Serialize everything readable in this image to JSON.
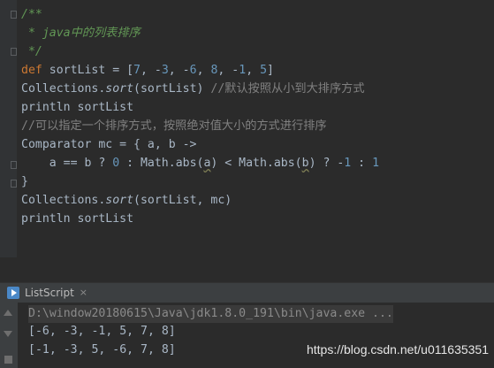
{
  "editor": {
    "lines": [
      {
        "tokens": [
          {
            "cls": "doc",
            "text": "/**"
          }
        ]
      },
      {
        "tokens": [
          {
            "cls": "doc",
            "text": " * java中的列表排序"
          }
        ]
      },
      {
        "tokens": [
          {
            "cls": "doc",
            "text": " */"
          }
        ]
      },
      {
        "tokens": [
          {
            "cls": "kw",
            "text": "def "
          },
          {
            "cls": "",
            "text": "sortList = ["
          },
          {
            "cls": "num",
            "text": "7"
          },
          {
            "cls": "",
            "text": ", -"
          },
          {
            "cls": "num",
            "text": "3"
          },
          {
            "cls": "",
            "text": ", -"
          },
          {
            "cls": "num",
            "text": "6"
          },
          {
            "cls": "",
            "text": ", "
          },
          {
            "cls": "num",
            "text": "8"
          },
          {
            "cls": "",
            "text": ", -"
          },
          {
            "cls": "num",
            "text": "1"
          },
          {
            "cls": "",
            "text": ", "
          },
          {
            "cls": "num",
            "text": "5"
          },
          {
            "cls": "",
            "text": "]"
          }
        ]
      },
      {
        "tokens": [
          {
            "cls": "",
            "text": "Collections."
          },
          {
            "cls": "it",
            "text": "sort"
          },
          {
            "cls": "",
            "text": "(sortList) "
          },
          {
            "cls": "cmt",
            "text": "//默认按照从小到大排序方式"
          }
        ]
      },
      {
        "tokens": [
          {
            "cls": "",
            "text": "println sortList"
          }
        ]
      },
      {
        "tokens": [
          {
            "cls": "cmt",
            "text": "//可以指定一个排序方式，按照绝对值大小的方式进行排序"
          }
        ]
      },
      {
        "tokens": [
          {
            "cls": "",
            "text": "Comparator mc = { a, b ->"
          }
        ]
      },
      {
        "tokens": [
          {
            "cls": "",
            "text": "    a == b ? "
          },
          {
            "cls": "num",
            "text": "0"
          },
          {
            "cls": "",
            "text": " : Math.abs("
          },
          {
            "cls": "under",
            "text": "a"
          },
          {
            "cls": "",
            "text": ") < Math.abs("
          },
          {
            "cls": "under",
            "text": "b"
          },
          {
            "cls": "",
            "text": ") ? -"
          },
          {
            "cls": "num",
            "text": "1"
          },
          {
            "cls": "",
            "text": " : "
          },
          {
            "cls": "num",
            "text": "1"
          }
        ]
      },
      {
        "tokens": [
          {
            "cls": "",
            "text": "}"
          }
        ]
      },
      {
        "tokens": [
          {
            "cls": "",
            "text": "Collections."
          },
          {
            "cls": "it",
            "text": "sort"
          },
          {
            "cls": "",
            "text": "(sortList, mc)"
          }
        ]
      },
      {
        "tokens": [
          {
            "cls": "",
            "text": "println sortList"
          }
        ]
      }
    ]
  },
  "run_tab": {
    "label": "ListScript",
    "close": "×"
  },
  "console": {
    "command": "D:\\window20180615\\Java\\jdk1.8.0_191\\bin\\java.exe ...",
    "outputs": [
      "[-6, -3, -1, 5, 7, 8]",
      "[-1, -3, 5, -6, 7, 8]"
    ]
  },
  "watermark": "https://blog.csdn.net/u011635351"
}
